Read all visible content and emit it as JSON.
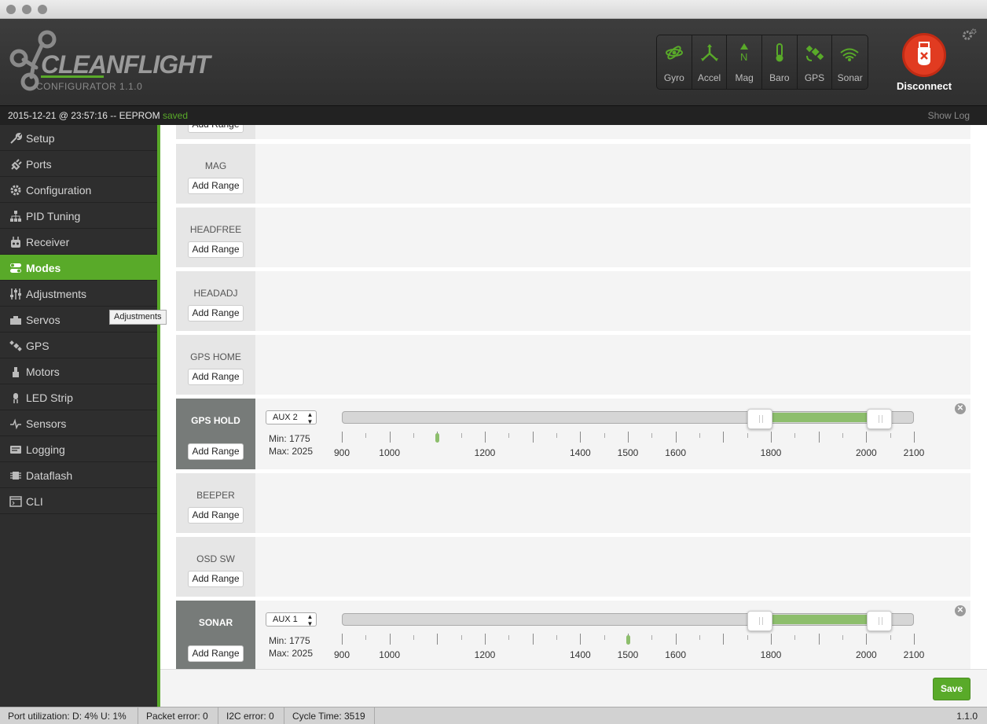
{
  "app": {
    "logo_text": "CLEANFLIGHT",
    "version_label": "CONFIGURATOR  1.1.0"
  },
  "sensors": [
    {
      "label": "Gyro",
      "icon": "gyro-icon"
    },
    {
      "label": "Accel",
      "icon": "accel-icon"
    },
    {
      "label": "Mag",
      "icon": "mag-icon"
    },
    {
      "label": "Baro",
      "icon": "baro-icon"
    },
    {
      "label": "GPS",
      "icon": "gps-satellite-icon"
    },
    {
      "label": "Sonar",
      "icon": "sonar-icon"
    }
  ],
  "connection": {
    "label": "Disconnect",
    "icon": "usb-disconnect-icon"
  },
  "status": {
    "timestamp": "2015-12-21 @ 23:57:16 -- EEPROM",
    "state": "saved",
    "show_log": "Show Log"
  },
  "sidebar": {
    "items": [
      {
        "label": "Setup",
        "icon": "wrench-icon",
        "active": false
      },
      {
        "label": "Ports",
        "icon": "plug-icon",
        "active": false
      },
      {
        "label": "Configuration",
        "icon": "gear-icon",
        "active": false
      },
      {
        "label": "PID Tuning",
        "icon": "sitemap-icon",
        "active": false
      },
      {
        "label": "Receiver",
        "icon": "receiver-icon",
        "active": false
      },
      {
        "label": "Modes",
        "icon": "toggle-icon",
        "active": true
      },
      {
        "label": "Adjustments",
        "icon": "sliders-icon",
        "active": false
      },
      {
        "label": "Servos",
        "icon": "servo-icon",
        "active": false
      },
      {
        "label": "GPS",
        "icon": "satellite-icon",
        "active": false
      },
      {
        "label": "Motors",
        "icon": "motor-icon",
        "active": false
      },
      {
        "label": "LED Strip",
        "icon": "led-icon",
        "active": false
      },
      {
        "label": "Sensors",
        "icon": "pulse-icon",
        "active": false
      },
      {
        "label": "Logging",
        "icon": "logging-icon",
        "active": false
      },
      {
        "label": "Dataflash",
        "icon": "chip-icon",
        "active": false
      },
      {
        "label": "CLI",
        "icon": "terminal-icon",
        "active": false
      }
    ],
    "tooltip": "Adjustments"
  },
  "modes": {
    "add_range_label": "Add Range",
    "min_prefix": "Min: ",
    "max_prefix": "Max: ",
    "scale": {
      "min": 900,
      "max": 2100
    },
    "scale_labels": [
      900,
      1000,
      1200,
      1400,
      1500,
      1600,
      1800,
      2000,
      2100
    ],
    "items": [
      {
        "name": "MAG",
        "active": false
      },
      {
        "name": "HEADFREE",
        "active": false
      },
      {
        "name": "HEADADJ",
        "active": false
      },
      {
        "name": "GPS HOME",
        "active": false
      },
      {
        "name": "GPS HOLD",
        "active": true,
        "channel": "AUX 2",
        "min": 1775,
        "max": 2025,
        "current": 1100
      },
      {
        "name": "BEEPER",
        "active": false
      },
      {
        "name": "OSD SW",
        "active": false
      },
      {
        "name": "SONAR",
        "active": true,
        "channel": "AUX 1",
        "min": 1775,
        "max": 2025,
        "current": 1500
      }
    ]
  },
  "save_label": "Save",
  "footer": {
    "port_util": "Port utilization: D: 4% U: 1%",
    "packet_error": "Packet error: 0",
    "i2c_error": "I2C error: 0",
    "cycle_time": "Cycle Time: 3519",
    "version": "1.1.0"
  },
  "colors": {
    "accent": "#59aa29",
    "header_bg": "#363636",
    "sidebar_bg": "#2e2e2e",
    "disconnect": "#e13b21",
    "range_fill": "#8dbe6c"
  }
}
